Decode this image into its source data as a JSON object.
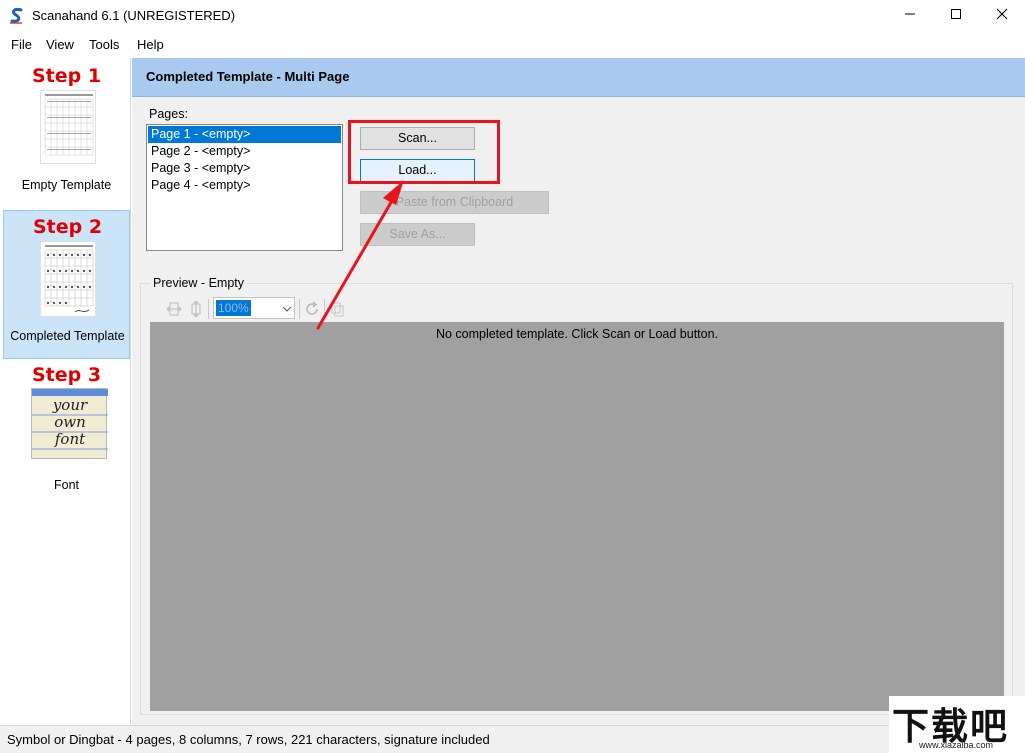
{
  "window": {
    "title": "Scanahand 6.1 (UNREGISTERED)",
    "controls": [
      "minimize",
      "maximize",
      "close"
    ]
  },
  "menu": [
    "File",
    "View",
    "Tools",
    "Help"
  ],
  "steps": [
    {
      "title": "Step 1",
      "caption": "Empty Template",
      "selected": false
    },
    {
      "title": "Step 2",
      "caption": "Completed Template",
      "selected": true
    },
    {
      "title": "Step 3",
      "caption": "Font",
      "selected": false,
      "thumb_text": [
        "your",
        "own",
        "font"
      ]
    }
  ],
  "header": {
    "title": "Completed Template - Multi Page"
  },
  "pages": {
    "label": "Pages:",
    "items": [
      "Page 1 - <empty>",
      "Page 2 - <empty>",
      "Page 3 - <empty>",
      "Page 4 - <empty>"
    ],
    "selected_index": 0
  },
  "buttons": {
    "scan": "Scan...",
    "load": "Load...",
    "paste": "Paste from Clipboard",
    "save_as": "Save As..."
  },
  "preview": {
    "label": "Preview - Empty",
    "zoom": "100%",
    "message": "No completed template. Click Scan or Load button."
  },
  "status": "Symbol or Dingbat - 4 pages, 8 columns, 7 rows, 221 characters, signature included",
  "watermark": {
    "logo": "下载吧",
    "url": "www.xiazaiba.com"
  },
  "colors": {
    "header_band": "#a9c9ee",
    "selection": "#0078d7",
    "step_title": "#e00000",
    "annotation_red": "#e8131b",
    "preview_bg": "#a0a0a0"
  },
  "icons": [
    "app-logo-icon",
    "minimize-icon",
    "maximize-icon",
    "close-icon",
    "fit-width-icon",
    "fit-height-icon",
    "chevron-down-icon",
    "rotate-icon",
    "copy-icon"
  ]
}
